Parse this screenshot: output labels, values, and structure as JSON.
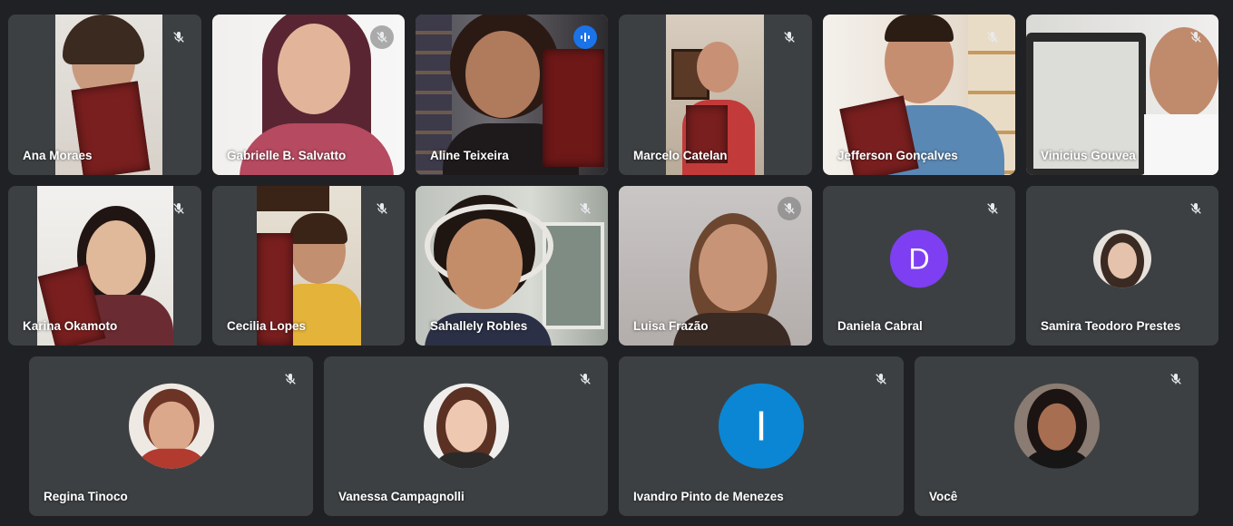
{
  "participants": [
    {
      "name": "Ana Moraes",
      "muted": true
    },
    {
      "name": "Gabrielle B. Salvatto",
      "muted": true
    },
    {
      "name": "Aline Teixeira",
      "muted": false,
      "speaking": true
    },
    {
      "name": "Marcelo Catelan",
      "muted": true
    },
    {
      "name": "Jefferson Gonçalves",
      "muted": true
    },
    {
      "name": "Vinicius Gouvea",
      "muted": true
    },
    {
      "name": "Karina Okamoto",
      "muted": true
    },
    {
      "name": "Cecilia Lopes",
      "muted": true
    },
    {
      "name": "Sahallely Robles",
      "muted": true
    },
    {
      "name": "Luisa Frazão",
      "muted": true
    },
    {
      "name": "Daniela Cabral",
      "muted": true,
      "initial": "D",
      "avatar_color": "#7e3ff2"
    },
    {
      "name": "Samira Teodoro Prestes",
      "muted": true
    },
    {
      "name": "Regina Tinoco",
      "muted": true
    },
    {
      "name": "Vanessa Campagnolli",
      "muted": true
    },
    {
      "name": "Ivandro Pinto de Menezes",
      "muted": true,
      "initial": "I",
      "avatar_color": "#0b86d4"
    },
    {
      "name": "Você",
      "muted": true
    }
  ],
  "icons": {
    "muted": "mic-off-icon",
    "speaking": "audio-level-icon"
  },
  "colors": {
    "background": "#202124",
    "tile": "#3c4043",
    "active_speaker": "#8ab4f8",
    "speaking_badge": "#1a73e8"
  }
}
